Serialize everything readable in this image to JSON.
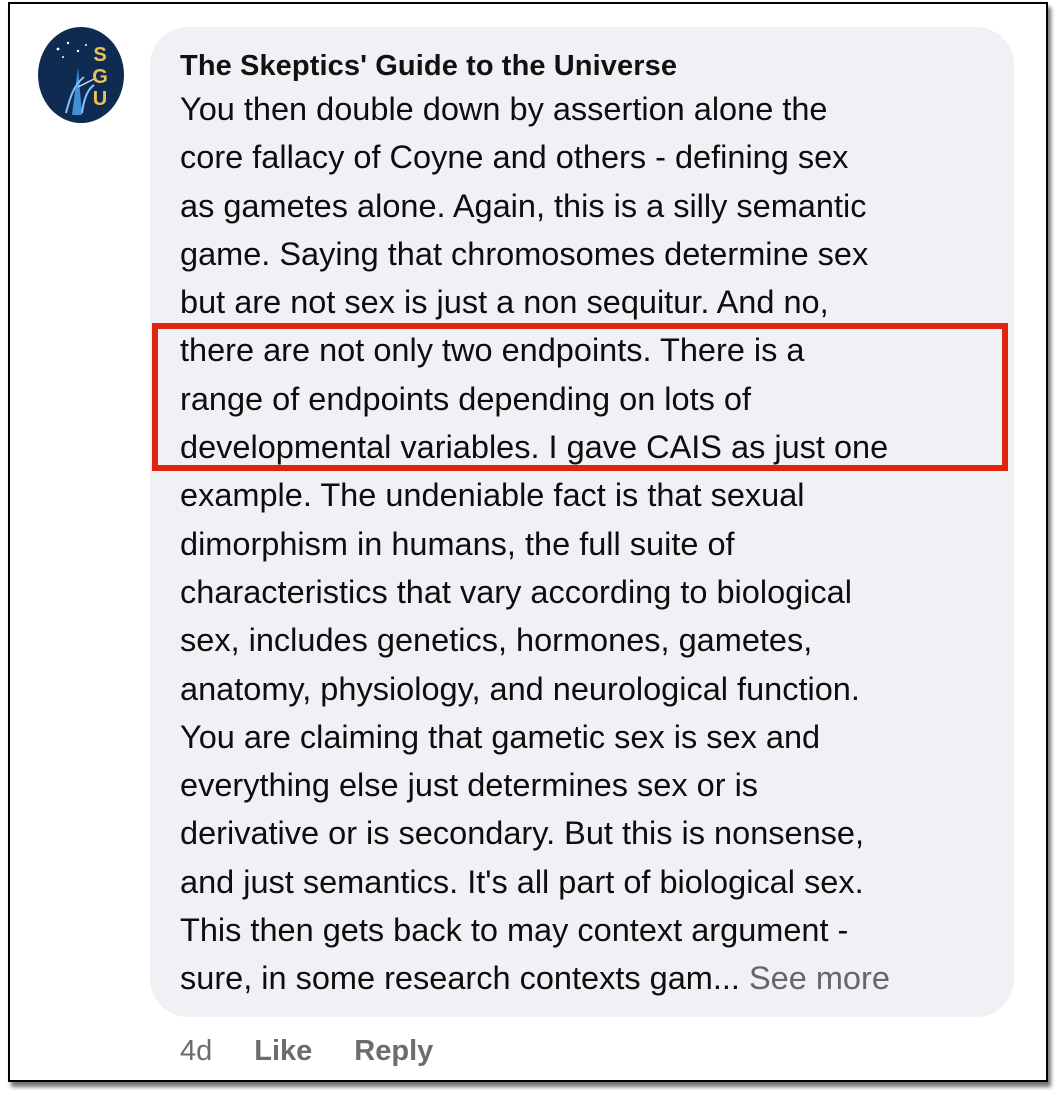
{
  "comment": {
    "author": "The Skeptics' Guide to the Universe",
    "avatar_label": "SGU",
    "lines": [
      "You then double down by assertion alone the",
      "core fallacy of Coyne and others - defining sex",
      "as gametes alone. Again, this is a silly semantic",
      "game. Saying that chromosomes determine sex",
      "but are not sex is just a non sequitur. And no,",
      "there are not only two endpoints. There is a",
      "range of endpoints depending on lots of",
      "developmental variables. I gave CAIS as just one",
      "example. The undeniable fact is that sexual",
      "dimorphism in humans, the full suite of",
      "characteristics that vary according to biological",
      "sex, includes genetics, hormones, gametes,",
      "anatomy, physiology, and neurological function.",
      "You are claiming that gametic sex is sex and",
      "everything else just determines sex or is",
      "derivative or is secondary. But this is nonsense,",
      "and just semantics. It's all part of biological sex.",
      "This then gets back to may context argument -",
      "sure, in some research contexts gam..."
    ],
    "see_more": "See more",
    "highlight_color": "#e0230f"
  },
  "actions": {
    "timestamp": "4d",
    "like": "Like",
    "reply": "Reply"
  },
  "colors": {
    "bubble_bg": "#f0f1f4",
    "muted_text": "#65676b",
    "avatar_bg": "#0f2b52",
    "avatar_text": "#e8c35a"
  }
}
